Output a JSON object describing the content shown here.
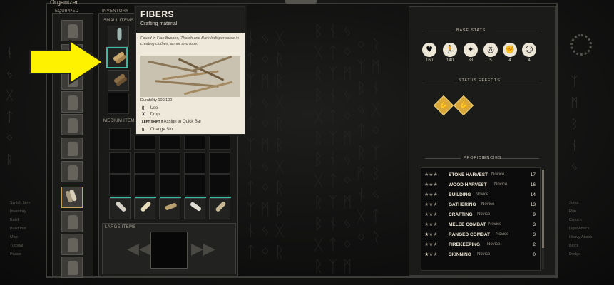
{
  "window": {
    "title": "Organizer"
  },
  "sections": {
    "equipped": "EQUIPPED",
    "inventory": "INVENTORY",
    "small_items": "SMALL ITEMS",
    "medium_items": "MEDIUM ITEMS",
    "large_items": "LARGE ITEMS"
  },
  "tooltip": {
    "name": "FIBERS",
    "category": "Crafting material",
    "description": "Found in Flax Bushes, Thatch and Bark Indispensable in creating clothes, armor and rope.",
    "durability": "Durability 100/100",
    "actions": [
      {
        "key": "▯",
        "label": "Use"
      },
      {
        "key": "X",
        "label": "Drop"
      },
      {
        "key": "LEFT SHIFT ▯",
        "label": "Assign to Quick Bar"
      },
      {
        "key": "▯",
        "label": "Change Slot"
      }
    ]
  },
  "base_stats": {
    "title": "BASE STATS",
    "stats": [
      {
        "icon": "heart-icon",
        "glyph": "♥",
        "value": "160"
      },
      {
        "icon": "running-icon",
        "glyph": "🏃",
        "value": "140"
      },
      {
        "icon": "agility-icon",
        "glyph": "✦",
        "value": "33"
      },
      {
        "icon": "target-icon",
        "glyph": "◎",
        "value": "5"
      },
      {
        "icon": "fist-icon",
        "glyph": "✊",
        "value": "4"
      },
      {
        "icon": "head-icon",
        "glyph": "☺",
        "value": "4"
      }
    ]
  },
  "status_effects": {
    "title": "STATUS EFFECTS",
    "effects": [
      {
        "icon": "arm-effect-icon",
        "glyph": "💪"
      },
      {
        "icon": "arm-effect-icon",
        "glyph": "💪"
      }
    ]
  },
  "proficiencies": {
    "title": "PROFICIENCIES",
    "items": [
      {
        "name": "STONE HARVEST",
        "level": "Novice",
        "value": "17",
        "stars": 0
      },
      {
        "name": "WOOD HARVEST",
        "level": "Novice",
        "value": "16",
        "stars": 0
      },
      {
        "name": "BUILDING",
        "level": "Novice",
        "value": "14",
        "stars": 0
      },
      {
        "name": "GATHERING",
        "level": "Novice",
        "value": "13",
        "stars": 0
      },
      {
        "name": "CRAFTING",
        "level": "Novice",
        "value": "9",
        "stars": 0
      },
      {
        "name": "MELEE COMBAT",
        "level": "Novice",
        "value": "3",
        "stars": 0
      },
      {
        "name": "RANGED COMBAT",
        "level": "Novice",
        "value": "3",
        "stars": 0.5
      },
      {
        "name": "FIREKEEPING",
        "level": "Novice",
        "value": "2",
        "stars": 0
      },
      {
        "name": "SKINNING",
        "level": "Novice",
        "value": "0",
        "stars": 0.3
      }
    ]
  },
  "left_hints": [
    "Switch Item",
    "Inventory",
    "Build",
    "Build tool",
    "Map",
    "Tutorial",
    "Pause"
  ],
  "right_hints": [
    "Jump",
    "Run",
    "Crouch",
    "Light Attack",
    "Heavy Attack",
    "Block",
    "Dodge"
  ],
  "colors": {
    "accent_green": "#39b9a0",
    "effect_gold": "#d9a83a",
    "arrow_yellow": "#fff200"
  }
}
